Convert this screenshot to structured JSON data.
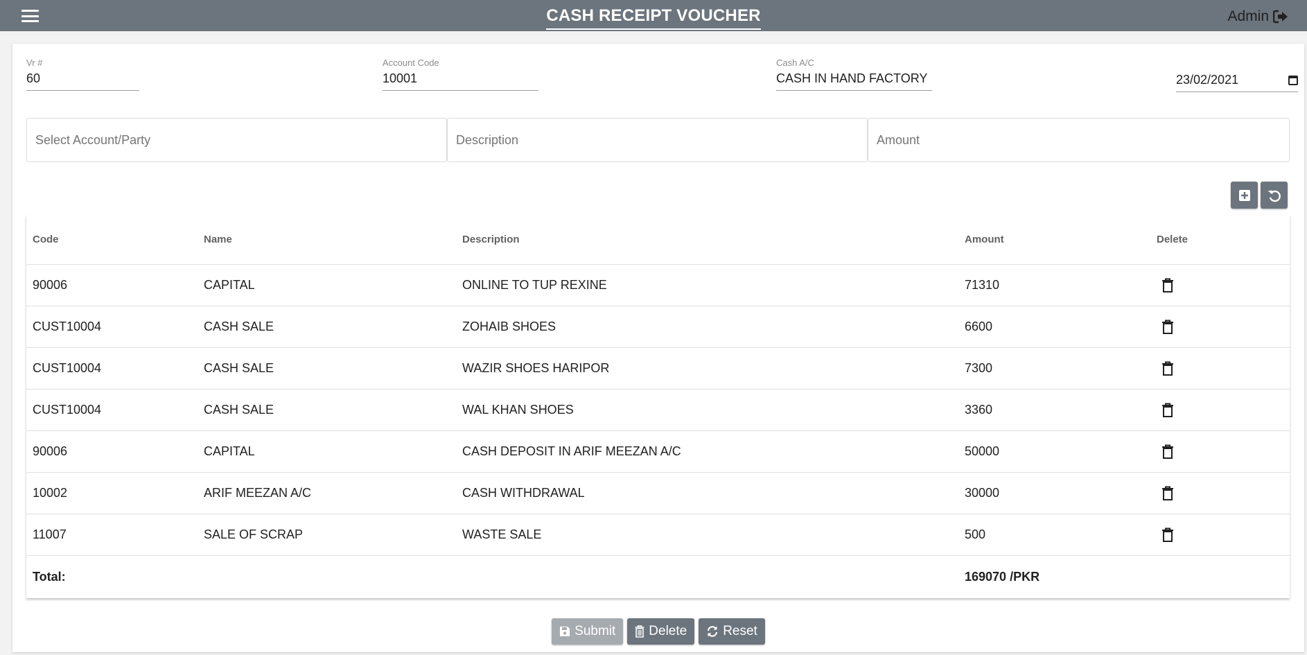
{
  "header": {
    "title": "CASH RECEIPT VOUCHER",
    "user": "Admin"
  },
  "form": {
    "vr_label": "Vr #",
    "vr_value": "60",
    "account_code_label": "Account Code",
    "account_code_value": "10001",
    "cash_ac_label": "Cash A/C",
    "cash_ac_value": "CASH IN HAND FACTORY",
    "date_value": "23/02/2021"
  },
  "entry": {
    "account_placeholder": "Select Account/Party",
    "description_placeholder": "Description",
    "amount_placeholder": "Amount"
  },
  "table": {
    "columns": [
      "Code",
      "Name",
      "Description",
      "Amount",
      "Delete"
    ],
    "rows": [
      {
        "code": "90006",
        "name": "CAPITAL",
        "description": "ONLINE TO TUP REXINE",
        "amount": "71310"
      },
      {
        "code": "CUST10004",
        "name": "CASH SALE",
        "description": "ZOHAIB SHOES",
        "amount": "6600"
      },
      {
        "code": "CUST10004",
        "name": "CASH SALE",
        "description": "WAZIR SHOES HARIPOR",
        "amount": "7300"
      },
      {
        "code": "CUST10004",
        "name": "CASH SALE",
        "description": "WAL KHAN SHOES",
        "amount": "3360"
      },
      {
        "code": "90006",
        "name": "CAPITAL",
        "description": "CASH DEPOSIT IN ARIF MEEZAN A/C",
        "amount": "50000"
      },
      {
        "code": "10002",
        "name": "ARIF MEEZAN A/C",
        "description": "CASH WITHDRAWAL",
        "amount": "30000"
      },
      {
        "code": "11007",
        "name": "SALE OF SCRAP",
        "description": "WASTE SALE",
        "amount": "500"
      }
    ],
    "total_label": "Total:",
    "total_value": "169070 /PKR"
  },
  "actions": {
    "submit": "Submit",
    "delete": "Delete",
    "reset": "Reset"
  },
  "icons": {
    "menu": "menu-icon",
    "logout": "sign-out-icon",
    "calendar": "calendar-icon",
    "add": "plus-square-icon",
    "undo": "undo-icon",
    "trash": "trash-icon",
    "save": "save-icon",
    "refresh": "refresh-icon"
  },
  "colors": {
    "topbar": "#6c747d",
    "button": "#6c747d",
    "button_disabled": "#a6abb0"
  }
}
